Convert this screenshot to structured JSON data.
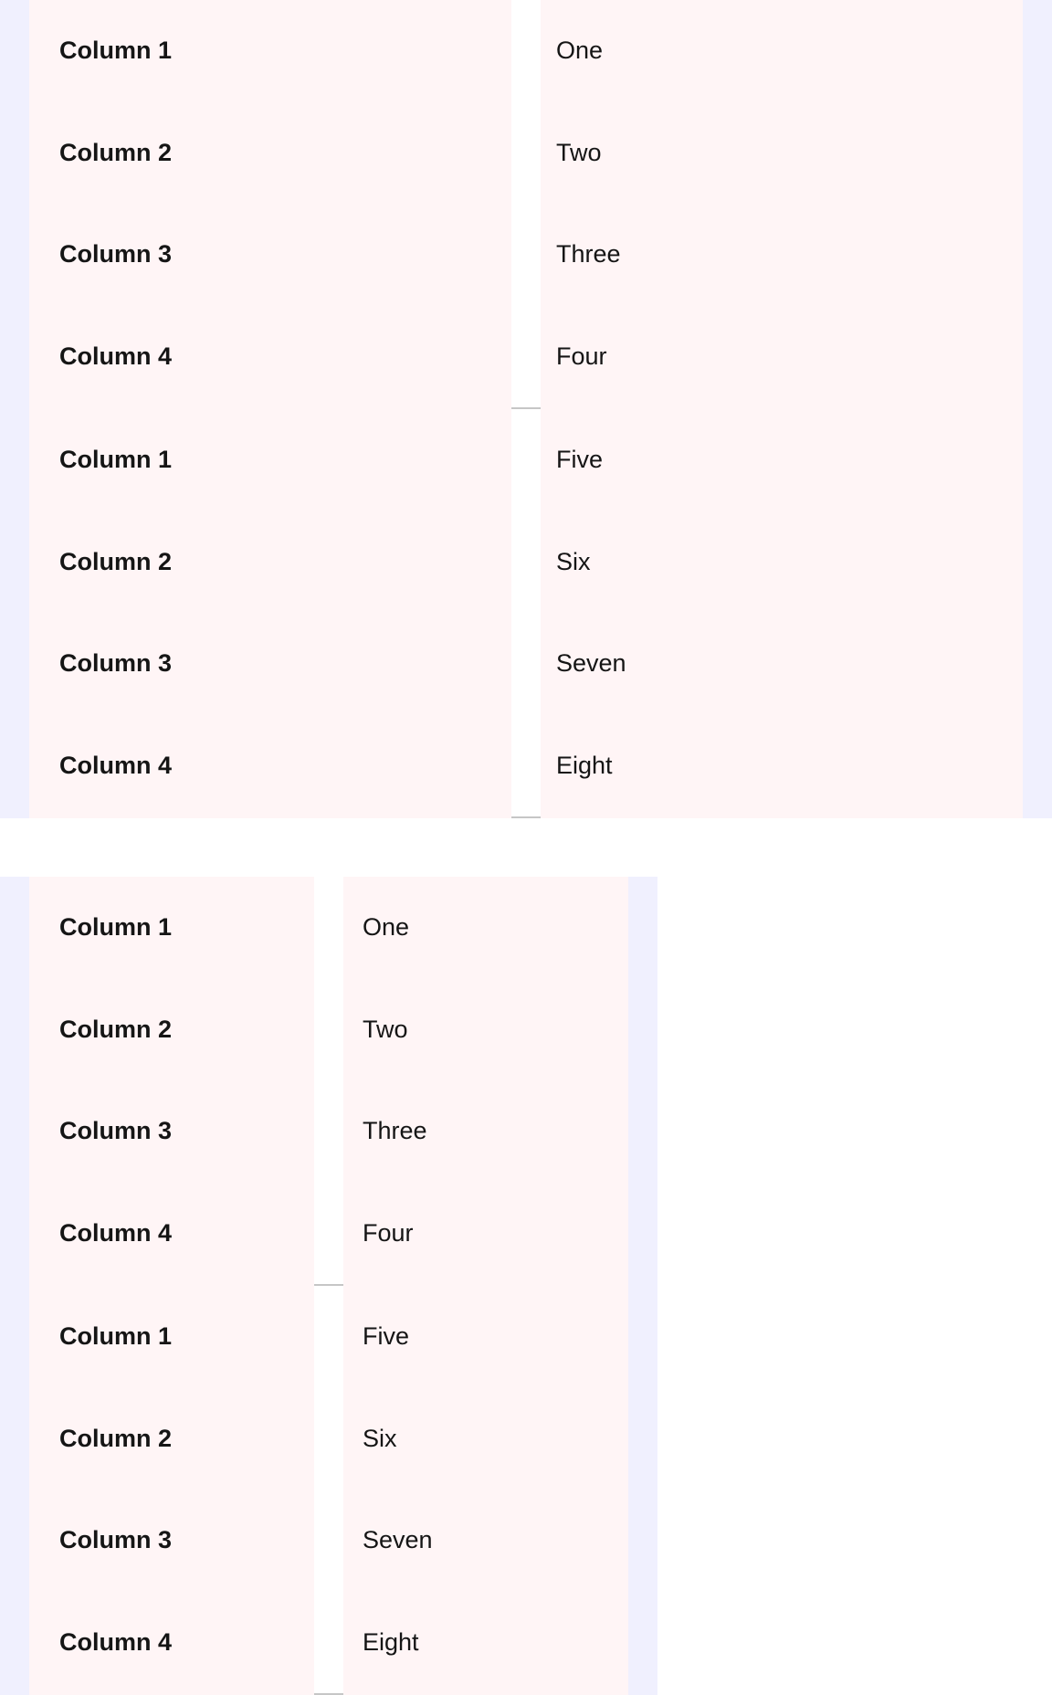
{
  "colors": {
    "container_bg": "#f0f0fe",
    "cell_bg": "#fff5f6",
    "divider": "#c6c6c6",
    "text": "#151515"
  },
  "tables": [
    {
      "groups": [
        {
          "rows": [
            {
              "header": "Column 1",
              "value": "One"
            },
            {
              "header": "Column 2",
              "value": "Two"
            },
            {
              "header": "Column 3",
              "value": "Three"
            },
            {
              "header": "Column 4",
              "value": "Four"
            }
          ]
        },
        {
          "rows": [
            {
              "header": "Column 1",
              "value": "Five"
            },
            {
              "header": "Column 2",
              "value": "Six"
            },
            {
              "header": "Column 3",
              "value": "Seven"
            },
            {
              "header": "Column 4",
              "value": "Eight"
            }
          ]
        }
      ]
    },
    {
      "groups": [
        {
          "rows": [
            {
              "header": "Column 1",
              "value": "One"
            },
            {
              "header": "Column 2",
              "value": "Two"
            },
            {
              "header": "Column 3",
              "value": "Three"
            },
            {
              "header": "Column 4",
              "value": "Four"
            }
          ]
        },
        {
          "rows": [
            {
              "header": "Column 1",
              "value": "Five"
            },
            {
              "header": "Column 2",
              "value": "Six"
            },
            {
              "header": "Column 3",
              "value": "Seven"
            },
            {
              "header": "Column 4",
              "value": "Eight"
            }
          ]
        }
      ]
    }
  ]
}
